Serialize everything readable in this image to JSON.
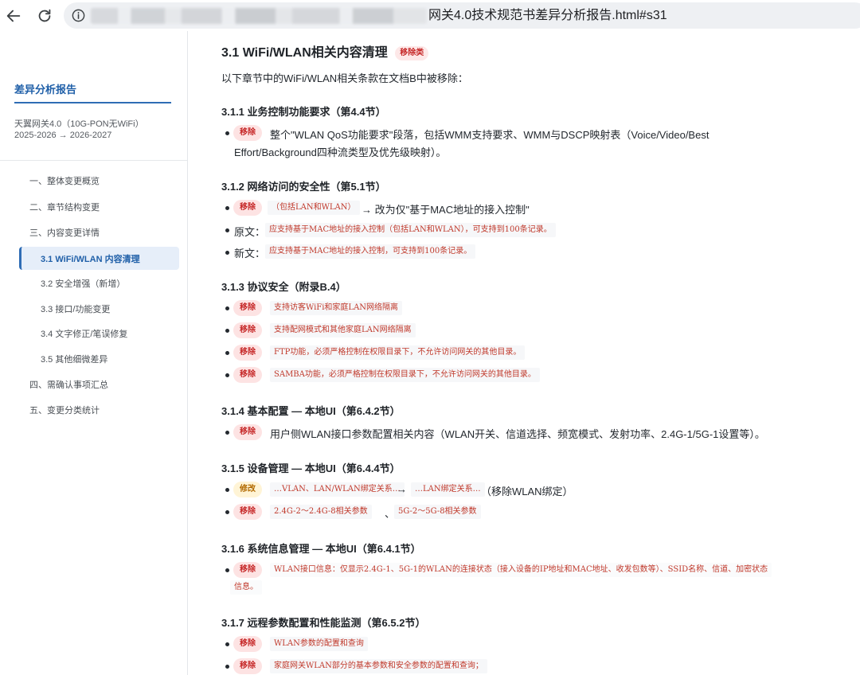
{
  "browser": {
    "url_visible": "网关4.0技术规范书差异分析报告.html#s31"
  },
  "sidebar": {
    "title": "差异分析报告",
    "meta_line1": "天翼网关4.0（10G-PON无WiFi）",
    "meta_line2": "2025-2026 → 2026-2027",
    "toc": [
      {
        "label": "一、整体变更概览"
      },
      {
        "label": "二、章节结构变更"
      },
      {
        "label": "三、内容变更详情"
      },
      {
        "label": "3.1 WiFi/WLAN 内容清理"
      },
      {
        "label": "3.2 安全增强（新增）"
      },
      {
        "label": "3.3 接口/功能变更"
      },
      {
        "label": "3.4 文字修正/笔误修复"
      },
      {
        "label": "3.5 其他细微差异"
      },
      {
        "label": "四、需确认事项汇总"
      },
      {
        "label": "五、变更分类统计"
      }
    ]
  },
  "main": {
    "title": "3.1 WiFi/WLAN相关内容清理",
    "title_badge": "移除类",
    "intro": "以下章节中的WiFi/WLAN相关条款在文档B中被移除：",
    "tag_remove": "移除",
    "tag_modify": "修改",
    "s311": {
      "heading": "3.1.1 业务控制功能要求（第4.4节）",
      "line1": "整个\"WLAN QoS功能要求\"段落，包括WMM支持要求、WMM与DSCP映射表（Voice/Video/Best",
      "line2": "Effort/Background四种流类型及优先级映射）。"
    },
    "s312": {
      "heading": "3.1.2 网络访问的安全性（第5.1节）",
      "removed": "（包括LAN和WLAN）",
      "arrow_text": "→ 改为仅\"基于MAC地址的接入控制\"",
      "orig_label": "原文：",
      "orig_code": "应支持基于MAC地址的接入控制（包括LAN和WLAN），可支持到100条记录。",
      "new_label": "新文：",
      "new_code": "应支持基于MAC地址的接入控制，可支持到100条记录。"
    },
    "s313": {
      "heading": "3.1.3 协议安全（附录B.4）",
      "items": [
        "支持访客WiFi和家庭LAN网络隔离",
        "支持配网模式和其他家庭LAN网络隔离",
        "FTP功能，必须严格控制在权限目录下，不允许访问网关的其他目录。",
        "SAMBA功能，必须严格控制在权限目录下，不允许访问网关的其他目录。"
      ]
    },
    "s314": {
      "heading": "3.1.4 基本配置 — 本地UI（第6.4.2节）",
      "text": "用户侧WLAN接口参数配置相关内容（WLAN开关、信道选择、频宽模式、发射功率、2.4G-1/5G-1设置等）。"
    },
    "s315": {
      "heading": "3.1.5 设备管理 — 本地UI（第6.4.4节）",
      "mod_from": "…VLAN、LAN/WLAN绑定关系…",
      "arrow": "→",
      "mod_to": "…LAN绑定关系…",
      "mod_note": "（移除WLAN绑定）",
      "rm_a": "2.4G-2～2.4G-8相关参数",
      "sep": "、",
      "rm_b": "5G-2～5G-8相关参数"
    },
    "s316": {
      "heading": "3.1.6 系统信息管理 — 本地UI（第6.4.1节）",
      "line1": "WLAN接口信息：仅显示2.4G-1、5G-1的WLAN的连接状态（接入设备的IP地址和MAC地址、收发包数等）、SSID名称、信道、加密状态",
      "line2": "信息。"
    },
    "s317": {
      "heading": "3.1.7 远程参数配置和性能监测（第6.5.2节）",
      "items": [
        "WLAN参数的配置和查询",
        "家庭网关WLAN部分的基本参数和安全参数的配置和查询；"
      ]
    }
  },
  "colors": {
    "accent": "#1f5fa8",
    "remove_tag_bg": "#fde3e3",
    "remove_tag_fg": "#c62828",
    "modify_tag_bg": "#fff4d6",
    "modify_tag_fg": "#b26a00",
    "code_fg": "#c0392b"
  }
}
